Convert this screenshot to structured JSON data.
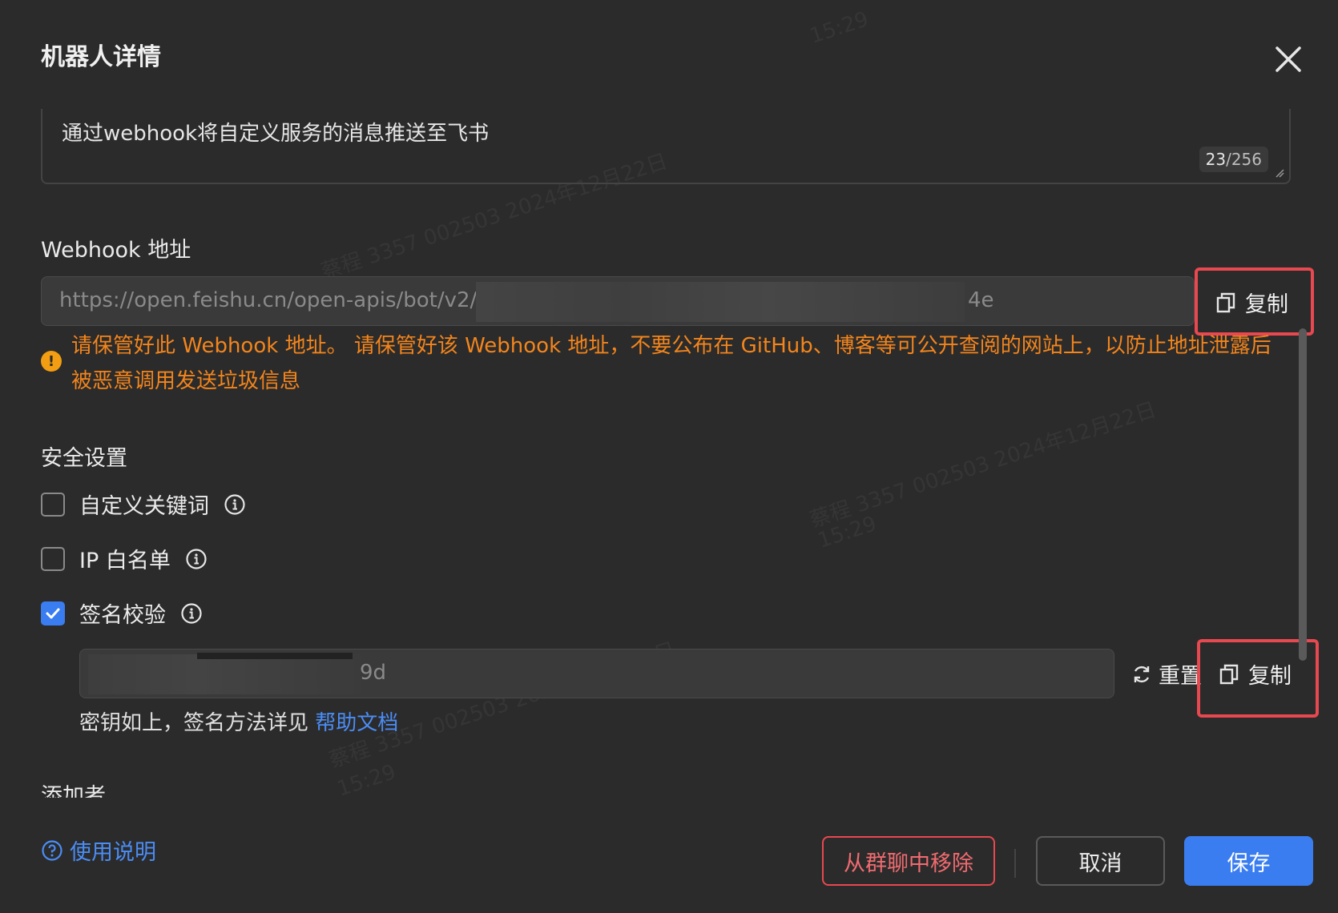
{
  "dialog": {
    "title": "机器人详情"
  },
  "description": {
    "value": "通过webhook将自定义服务的消息推送至飞书",
    "count": "23",
    "max": "/256"
  },
  "webhook": {
    "label": "Webhook 地址",
    "url_prefix": "https://open.feishu.cn/open-apis/bot/v2/",
    "url_suffix": "4e",
    "copy_label": "复制",
    "warning": "请保管好此 Webhook 地址。 请保管好该 Webhook 地址，不要公布在 GitHub、博客等可公开查阅的网站上，以防止地址泄露后被恶意调用发送垃圾信息"
  },
  "security": {
    "label": "安全设置",
    "options": [
      {
        "label": "自定义关键词",
        "checked": false
      },
      {
        "label": "IP 白名单",
        "checked": false
      },
      {
        "label": "签名校验",
        "checked": true
      }
    ],
    "secret_suffix": "9d",
    "reset_label": "重置",
    "copy_label": "复制",
    "hint": "密钥如上，签名方法详见 ",
    "hint_link": "帮助文档"
  },
  "adder_label": "添加者",
  "footer": {
    "help_label": "使用说明",
    "remove_label": "从群聊中移除",
    "cancel_label": "取消",
    "save_label": "保存"
  },
  "watermark": {
    "text_a": "蔡程 3357 002503 2024年12月22日",
    "text_b": "15:29"
  },
  "colors": {
    "accent": "#3a7df0",
    "warning": "#f3851c",
    "danger": "#e8484f"
  }
}
